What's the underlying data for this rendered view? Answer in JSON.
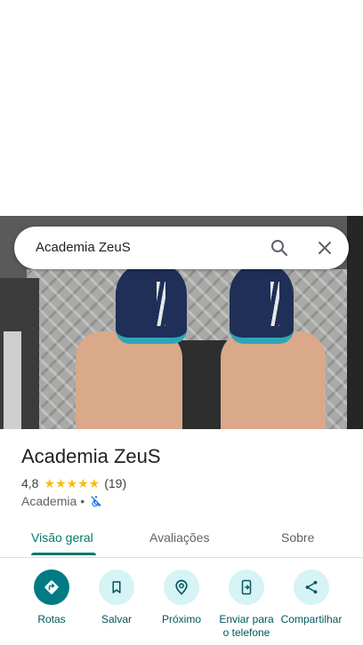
{
  "search": {
    "query": "Academia ZeuS"
  },
  "place": {
    "name": "Academia ZeuS",
    "rating": "4,8",
    "stars": "★★★★★",
    "review_count": "(19)",
    "category": "Academia",
    "separator": "•"
  },
  "tabs": [
    {
      "label": "Visão geral",
      "active": true
    },
    {
      "label": "Avaliações",
      "active": false
    },
    {
      "label": "Sobre",
      "active": false
    }
  ],
  "actions": [
    {
      "label": "Rotas",
      "icon": "directions-icon"
    },
    {
      "label": "Salvar",
      "icon": "bookmark-icon"
    },
    {
      "label": "Próximo",
      "icon": "nearby-icon"
    },
    {
      "label": "Enviar para o telefone",
      "icon": "send-to-phone-icon"
    },
    {
      "label": "Compartilhar",
      "icon": "share-icon"
    }
  ],
  "colors": {
    "accent": "#00796b",
    "primary_action": "#007b83",
    "action_bg": "#d6f3f6",
    "star": "#fbbc04"
  }
}
